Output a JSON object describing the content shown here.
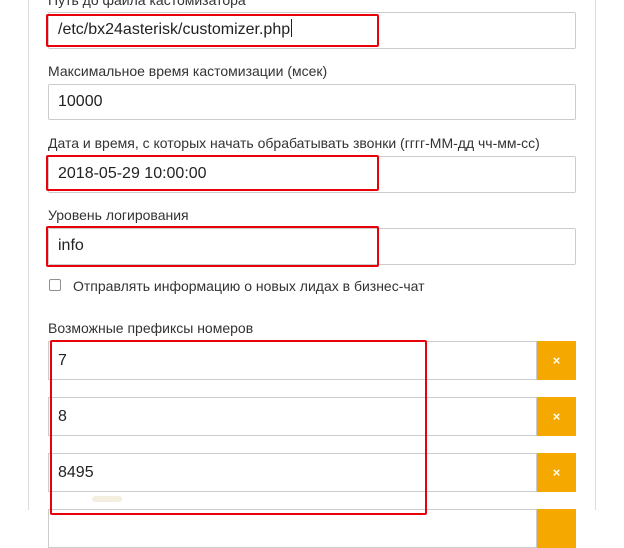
{
  "settings": {
    "customizer_path": {
      "label": "Путь до файла кастомизатора",
      "value": "/etc/bx24asterisk/customizer.php"
    },
    "max_customization_time": {
      "label": "Максимальное время кастомизации (мсек)",
      "value": "10000"
    },
    "start_datetime": {
      "label": "Дата и время, с которых начать обрабатывать звонки (гггг-ММ-дд чч-мм-сс)",
      "value": "2018-05-29 10:00:00"
    },
    "log_level": {
      "label": "Уровень логирования",
      "value": "info"
    },
    "send_leads_to_chat": {
      "label": "Отправлять информацию о новых лидах в бизнес-чат",
      "checked": false
    },
    "prefixes": {
      "label": "Возможные префиксы номеров",
      "remove_label": "×",
      "items": [
        "7",
        "8",
        "8495"
      ]
    }
  },
  "colors": {
    "highlight": "#e8000b",
    "remove_button": "#f5a800",
    "field_border": "#cccccc"
  }
}
